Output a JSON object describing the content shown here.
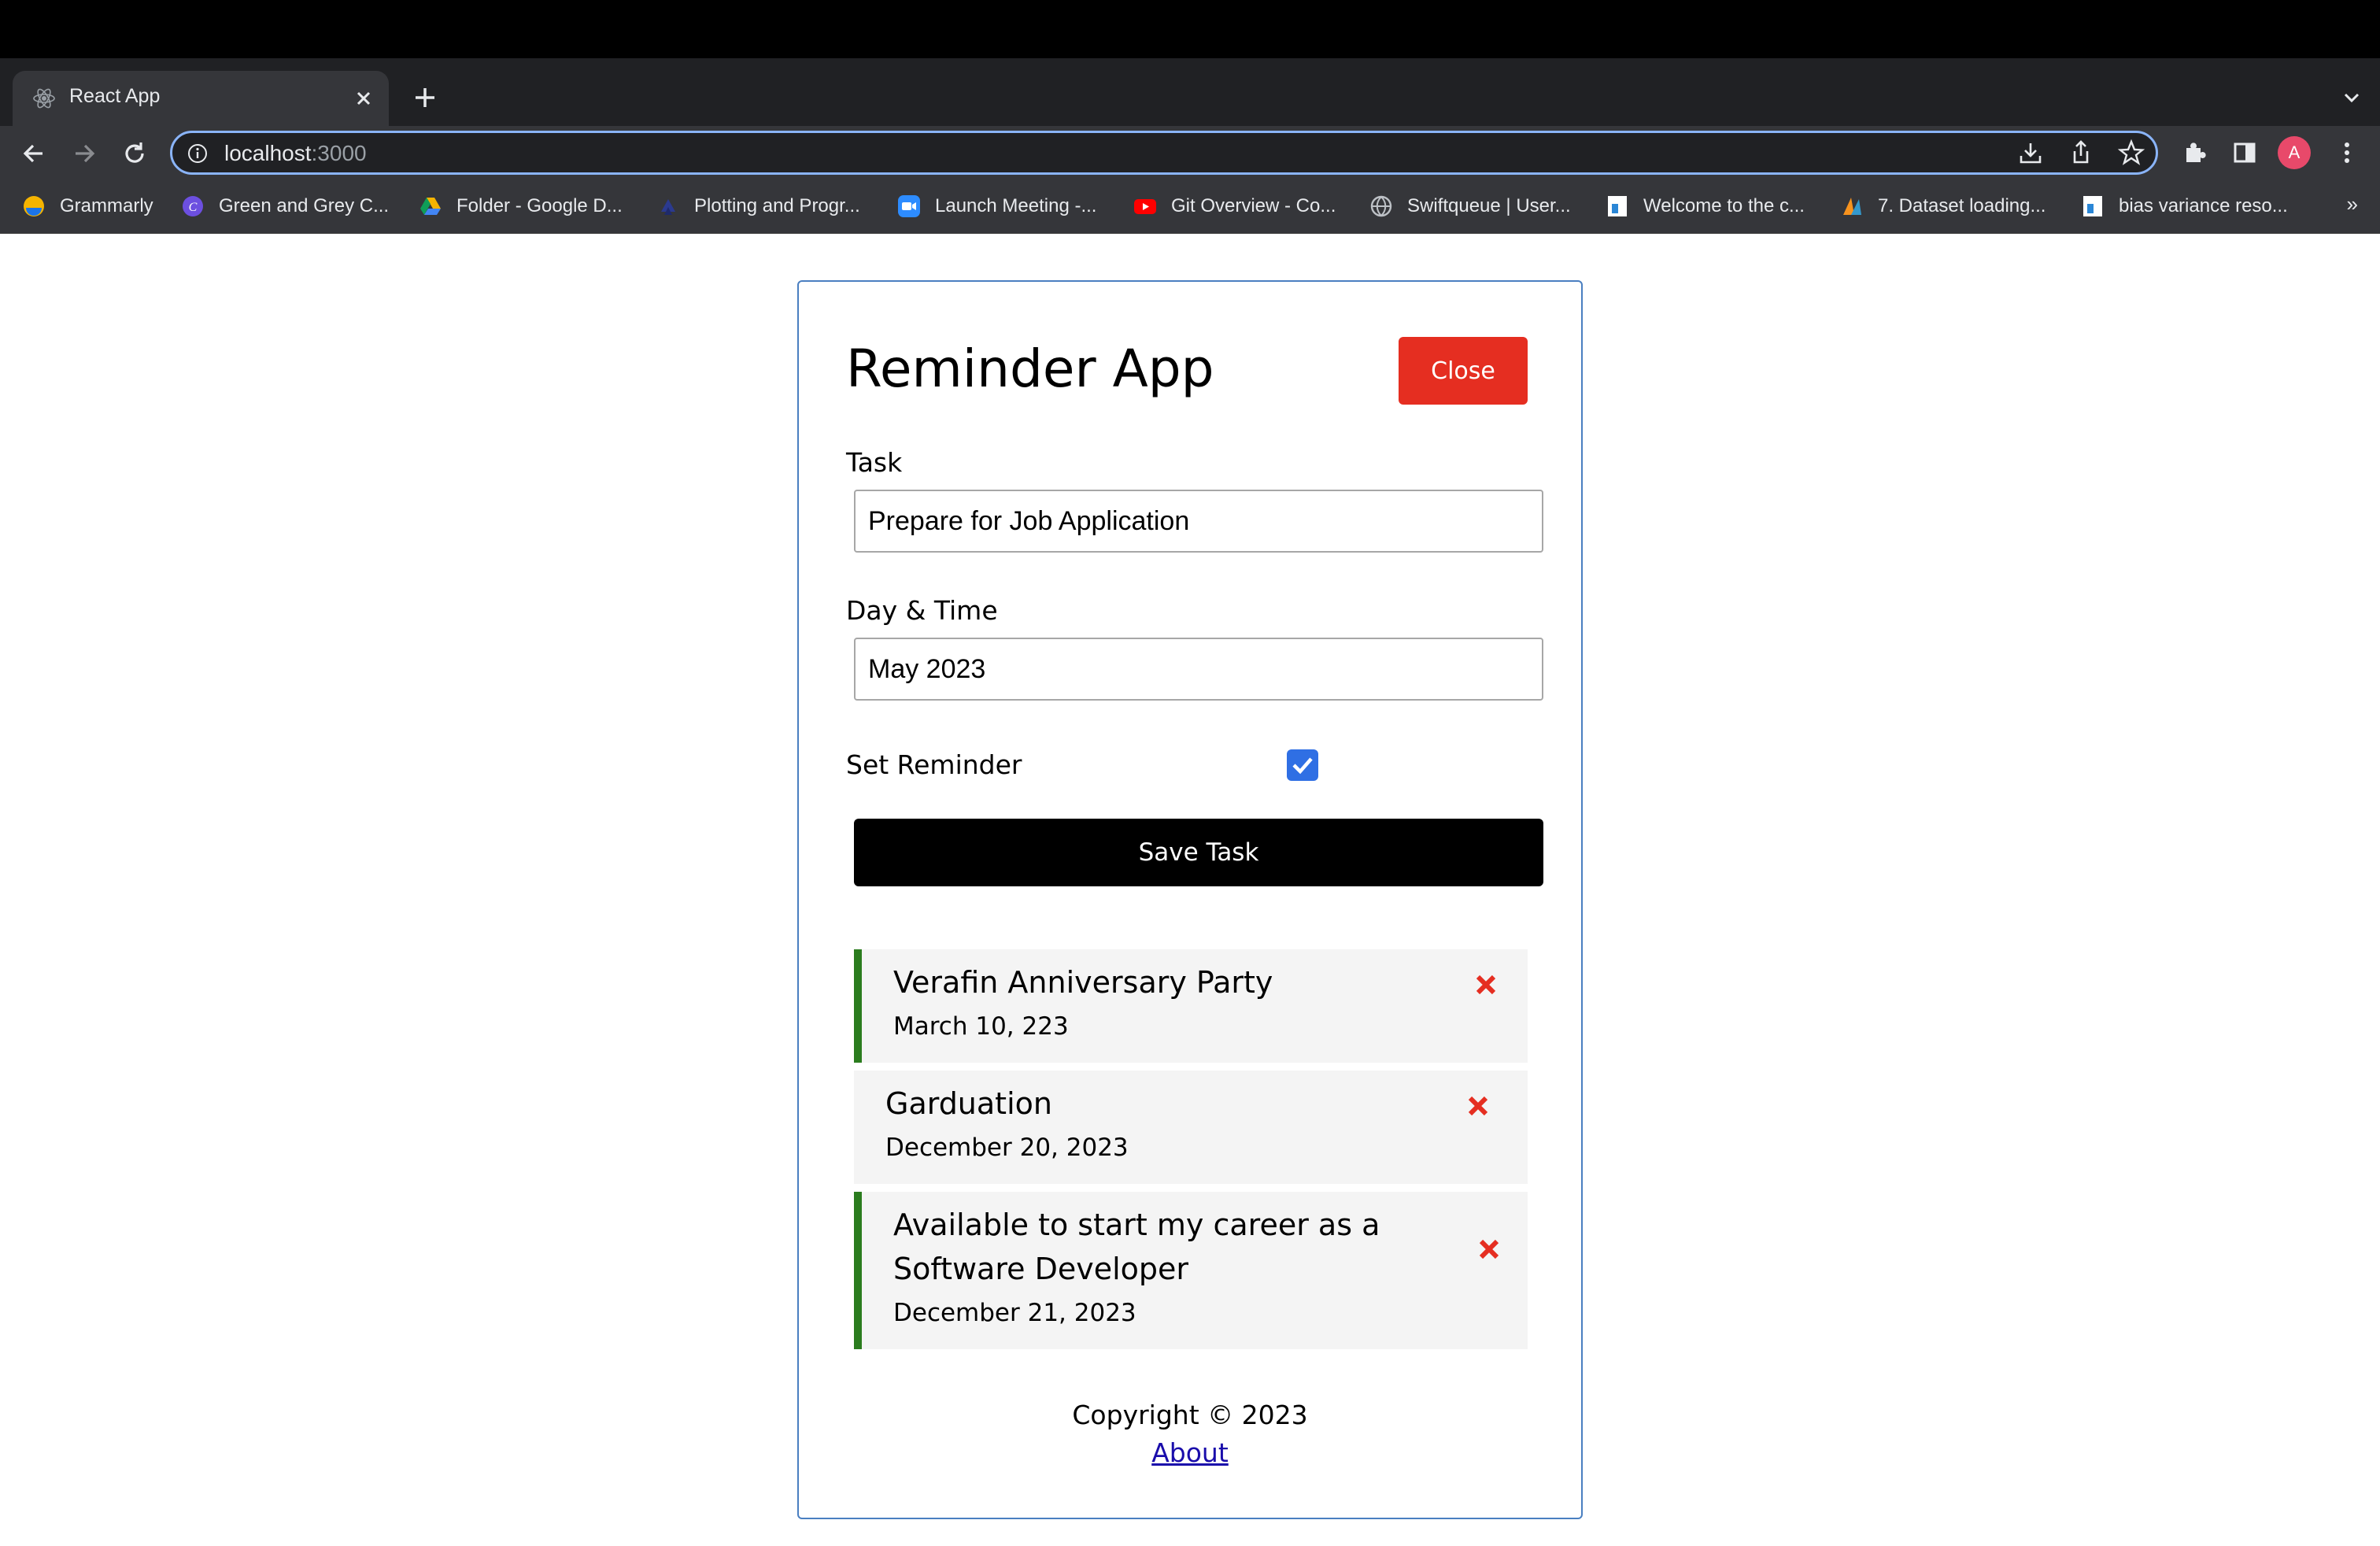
{
  "browser": {
    "tab_title": "React App",
    "url_host": "localhost",
    "url_port": ":3000",
    "avatar_letter": "A",
    "bookmarks": [
      {
        "label": "Grammarly",
        "icon": "grammarly-icon"
      },
      {
        "label": "Green and Grey C...",
        "icon": "canva-icon"
      },
      {
        "label": "Folder - Google D...",
        "icon": "google-drive-icon"
      },
      {
        "label": "Plotting and Progr...",
        "icon": "python-icon"
      },
      {
        "label": "Launch Meeting -...",
        "icon": "zoom-icon"
      },
      {
        "label": "Git Overview - Co...",
        "icon": "youtube-icon"
      },
      {
        "label": "Swiftqueue | User...",
        "icon": "globe-icon"
      },
      {
        "label": "Welcome to the c...",
        "icon": "document-icon"
      },
      {
        "label": "7. Dataset loading...",
        "icon": "scikit-icon"
      },
      {
        "label": "bias variance reso...",
        "icon": "document-icon"
      }
    ],
    "more_bookmarks": "»"
  },
  "app": {
    "title": "Reminder App",
    "close_label": "Close",
    "task_label": "Task",
    "task_value": "Prepare for Job Application",
    "day_label": "Day & Time",
    "day_value": "May 2023",
    "reminder_label": "Set Reminder",
    "reminder_checked": true,
    "save_label": "Save Task",
    "colors": {
      "close": "#e52e21",
      "reminder_border": "#2b7c1e",
      "delete": "#e52e21"
    }
  },
  "tasks": [
    {
      "title": "Verafin Anniversary Party",
      "date": "March 10, 223",
      "reminder": true
    },
    {
      "title": "Garduation",
      "date": "December 20, 2023",
      "reminder": false
    },
    {
      "title_line1": "Available to start my career as a",
      "title_line2": "Software Developer",
      "date": "December 21, 2023",
      "reminder": true
    }
  ],
  "footer": {
    "copyright": "Copyright © 2023",
    "about": "About"
  }
}
